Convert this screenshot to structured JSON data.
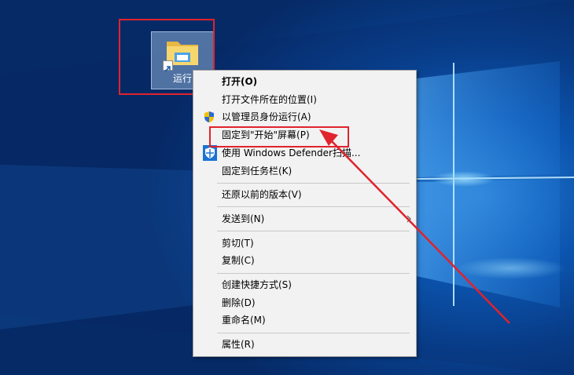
{
  "desktop_icon": {
    "label": "运行"
  },
  "context_menu": {
    "groups": [
      {
        "items": [
          {
            "label": "打开(O)",
            "bold": true
          },
          {
            "label": "打开文件所在的位置(I)"
          },
          {
            "label": "以管理员身份运行(A)",
            "icon": "uac-shield-icon"
          },
          {
            "label": "固定到\"开始\"屏幕(P)"
          },
          {
            "label": "使用 Windows Defender扫描...",
            "icon": "defender-shield-icon"
          },
          {
            "label": "固定到任务栏(K)"
          }
        ]
      },
      {
        "items": [
          {
            "label": "还原以前的版本(V)"
          }
        ]
      },
      {
        "items": [
          {
            "label": "发送到(N)",
            "submenu_icon": "chevron-right-icon"
          }
        ]
      },
      {
        "items": [
          {
            "label": "剪切(T)"
          },
          {
            "label": "复制(C)"
          }
        ]
      },
      {
        "items": [
          {
            "label": "创建快捷方式(S)"
          },
          {
            "label": "删除(D)"
          },
          {
            "label": "重命名(M)"
          }
        ]
      },
      {
        "items": [
          {
            "label": "属性(R)"
          }
        ]
      }
    ]
  },
  "annotation": {
    "color": "#e0232d"
  }
}
